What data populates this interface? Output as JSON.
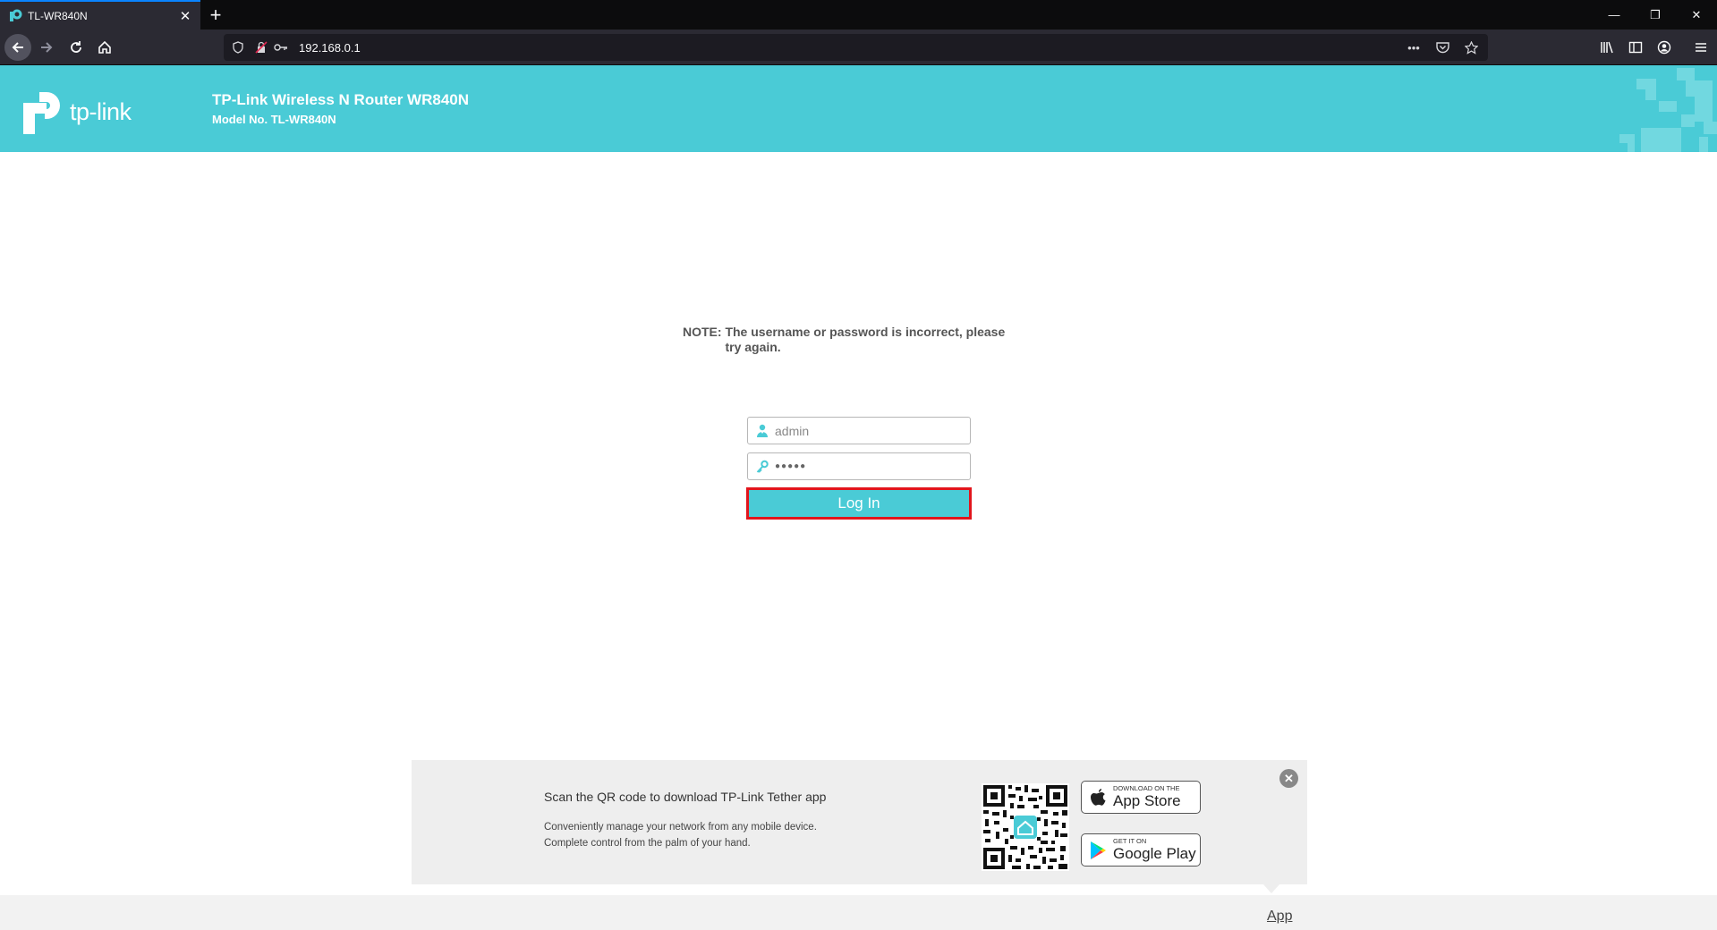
{
  "browser": {
    "tab_title": "TL-WR840N",
    "url": "192.168.0.1"
  },
  "header": {
    "logo_text": "tp-link",
    "title": "TP-Link Wireless N Router WR840N",
    "model": "Model No. TL-WR840N",
    "brand_color": "#4acbd6"
  },
  "login": {
    "note_label": "NOTE:",
    "note_message": "The username or password is incorrect, please try again.",
    "username_value": "admin",
    "password_value": "●●●●●",
    "login_label": "Log In",
    "button_border_color": "#e2151c"
  },
  "promo": {
    "title": "Scan the QR code to download TP-Link Tether app",
    "desc_line1": "Conveniently manage your network from any mobile device.",
    "desc_line2": "Complete control from the palm of your hand.",
    "appstore_small": "DOWNLOAD ON THE",
    "appstore_big": "App Store",
    "googleplay_small": "GET IT ON",
    "googleplay_big": "Google Play"
  },
  "footer": {
    "app_link": "App"
  }
}
